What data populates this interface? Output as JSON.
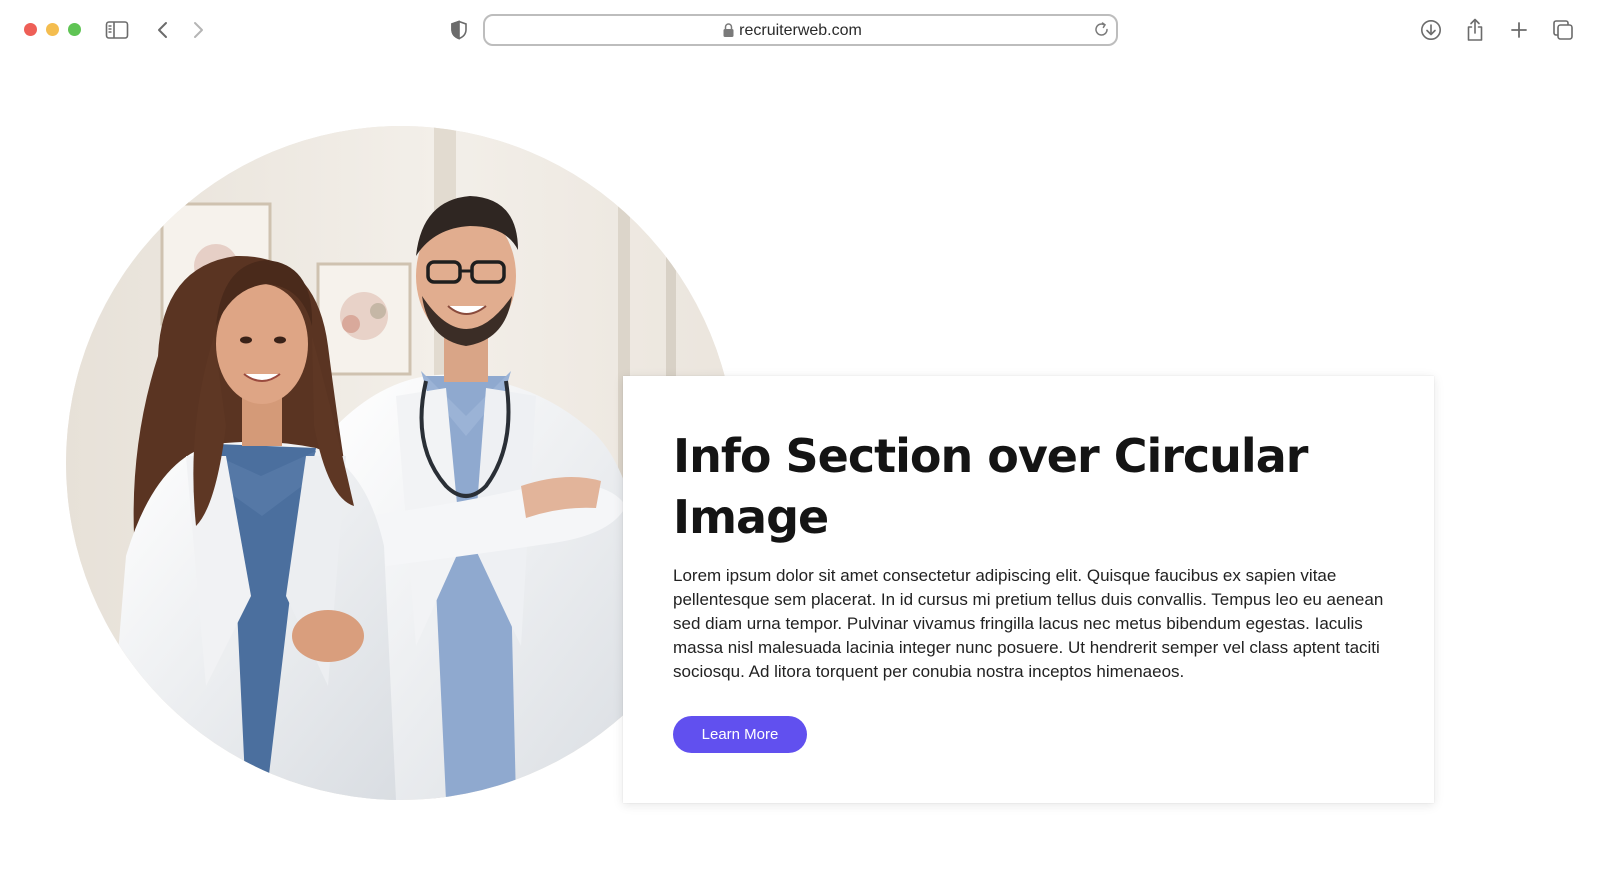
{
  "browser": {
    "url": "recruiterweb.com",
    "icons": [
      "sidebar-icon",
      "back-icon",
      "forward-icon",
      "privacy-shield-icon",
      "lock-icon",
      "reload-icon",
      "download-icon",
      "share-icon",
      "new-tab-icon",
      "tabs-overview-icon"
    ]
  },
  "hero": {
    "image_subject": "two-doctors-photo"
  },
  "info": {
    "title": "Info Section over Circular Image",
    "body": "Lorem ipsum dolor sit amet consectetur adipiscing elit. Quisque faucibus ex sapien vitae pellentesque sem placerat. In id cursus mi pretium tellus duis convallis. Tempus leo eu aenean sed diam urna tempor. Pulvinar vivamus fringilla lacus nec metus bibendum egestas. Iaculis massa nisl malesuada lacinia integer nunc posuere. Ut hendrerit semper vel class aptent taciti sociosqu. Ad litora torquent per conubia nostra inceptos himenaeos.",
    "button_label": "Learn More"
  },
  "colors": {
    "accent": "#6150ef",
    "traffic_red": "#ee5f57",
    "traffic_yellow": "#f4bd4f",
    "traffic_green": "#5fc454"
  }
}
